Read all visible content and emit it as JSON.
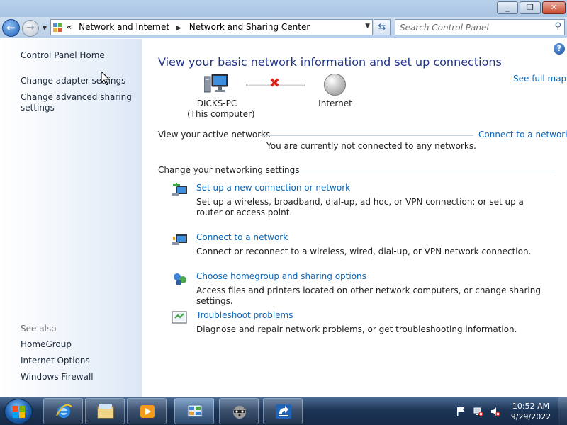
{
  "address_bar": {
    "overflow_chevron": "«",
    "breadcrumbs": [
      "Network and Internet",
      "Network and Sharing Center"
    ],
    "separator": "▶",
    "dropdown_glyph": "▼"
  },
  "search": {
    "placeholder": "Search Control Panel"
  },
  "sidebar": {
    "home": "Control Panel Home",
    "links": [
      "Change adapter settings",
      "Change advanced sharing\nsettings"
    ],
    "see_also_label": "See also",
    "see_also": [
      "HomeGroup",
      "Internet Options",
      "Windows Firewall"
    ]
  },
  "main": {
    "title": "View your basic network information and set up connections",
    "see_full_map": "See full map",
    "computer": {
      "name": "DICKS-PC",
      "subtitle": "(This computer)"
    },
    "internet_label": "Internet",
    "active_networks_heading": "View your active networks",
    "connect_link": "Connect to a network",
    "status_text": "You are currently not connected to any networks.",
    "settings_heading": "Change your networking settings",
    "tasks": [
      {
        "icon": "new-connection-icon",
        "title": "Set up a new connection or network",
        "desc": "Set up a wireless, broadband, dial-up, ad hoc, or VPN connection; or set up a router or access point."
      },
      {
        "icon": "connect-network-icon",
        "title": "Connect to a network",
        "desc": "Connect or reconnect to a wireless, wired, dial-up, or VPN network connection."
      },
      {
        "icon": "homegroup-icon",
        "title": "Choose homegroup and sharing options",
        "desc": "Access files and printers located on other network computers, or change sharing settings."
      },
      {
        "icon": "troubleshoot-icon",
        "title": "Troubleshoot problems",
        "desc": "Diagnose and repair network problems, or get troubleshooting information."
      }
    ]
  },
  "taskbar": {
    "apps": [
      "internet-explorer-icon",
      "windows-explorer-icon",
      "media-player-icon",
      "network-control-panel-icon",
      "raccoon-app-icon",
      "blue-arrow-app-icon"
    ],
    "time": "10:52 AM",
    "date": "9/29/2022"
  },
  "colors": {
    "link": "#0b66b8",
    "title": "#1e3287",
    "error": "#d8241a"
  }
}
